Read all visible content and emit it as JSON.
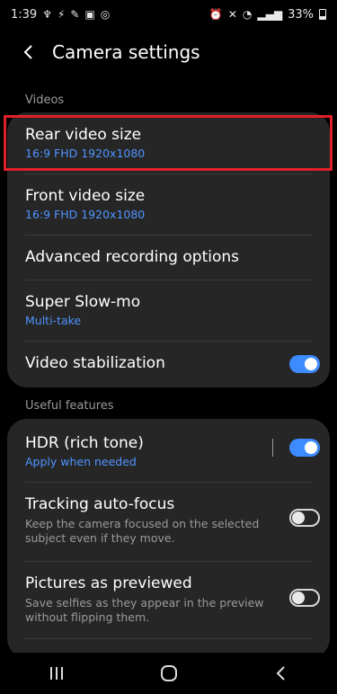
{
  "status_bar": {
    "time": "1:39",
    "battery": "33%"
  },
  "header": {
    "title": "Camera settings"
  },
  "sections": {
    "videos": "Videos",
    "useful": "Useful features"
  },
  "videos": {
    "rear": {
      "title": "Rear video size",
      "value": "16:9 FHD 1920x1080"
    },
    "front": {
      "title": "Front video size",
      "value": "16:9 FHD 1920x1080"
    },
    "advanced": {
      "title": "Advanced recording options"
    },
    "slowmo": {
      "title": "Super Slow-mo",
      "value": "Multi-take"
    },
    "stabilization": {
      "title": "Video stabilization",
      "enabled": true
    }
  },
  "useful": {
    "hdr": {
      "title": "HDR (rich tone)",
      "value": "Apply when needed",
      "enabled": true
    },
    "tracking": {
      "title": "Tracking auto-focus",
      "description": "Keep the camera focused on the selected subject even if they move.",
      "enabled": false
    },
    "previewed": {
      "title": "Pictures as previewed",
      "description": "Save selfies as they appear in the preview without flipping them.",
      "enabled": false
    }
  },
  "colors": {
    "accent": "#3d8bff",
    "highlight": "#e0202a"
  },
  "icons": {
    "back": "chevron-left-icon",
    "nav_recent": "recent-apps-icon",
    "nav_home": "home-icon",
    "nav_back": "nav-back-icon"
  }
}
